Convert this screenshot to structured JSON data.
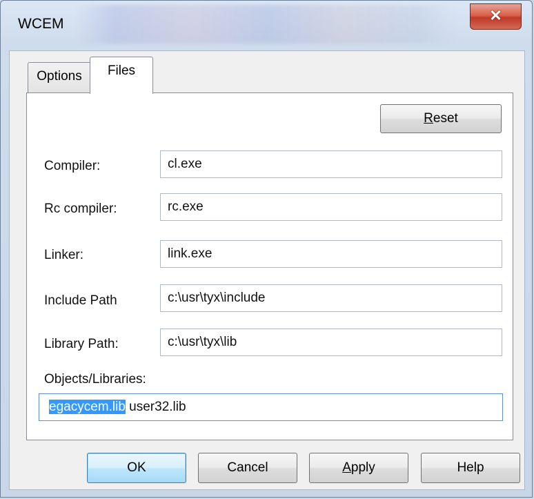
{
  "window": {
    "title": "WCEM",
    "close_glyph": "✕"
  },
  "tabs": [
    {
      "label": "Options",
      "selected": false
    },
    {
      "label": "Files",
      "selected": true
    }
  ],
  "reset_button": {
    "pre": "",
    "accel": "R",
    "post": "eset"
  },
  "fields": {
    "compiler": {
      "label": "Compiler:",
      "value": "cl.exe"
    },
    "rc_compiler": {
      "label": "Rc compiler:",
      "value": "rc.exe"
    },
    "linker": {
      "label": "Linker:",
      "value": "link.exe"
    },
    "include_path": {
      "label": "Include Path",
      "value": "c:\\usr\\tyx\\include"
    },
    "library_path": {
      "label": "Library Path:",
      "value": "c:\\usr\\tyx\\lib"
    },
    "objects_libraries": {
      "label": "Objects/Libraries:",
      "selected_text": "egacycem.lib",
      "rest_text": " user32.lib"
    }
  },
  "buttons": {
    "ok": "OK",
    "cancel": "Cancel",
    "apply": {
      "pre": "",
      "accel": "A",
      "post": "pply"
    },
    "help": "Help"
  },
  "colors": {
    "selection": "#3399ff",
    "close_button": "#c0392b",
    "ok_button_border": "#3c7fb1"
  }
}
